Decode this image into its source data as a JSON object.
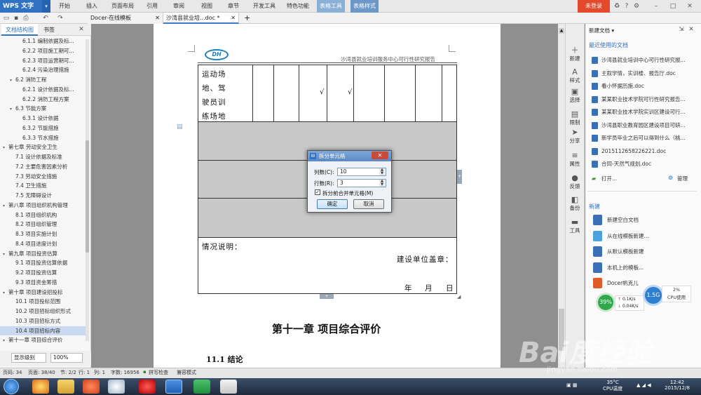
{
  "app": {
    "name": "WPS 文字",
    "dropdown": "▾"
  },
  "menu": [
    "开始",
    "插入",
    "页面布局",
    "引用",
    "审阅",
    "视图",
    "章节",
    "开发工具",
    "特色功能"
  ],
  "context_menu": [
    "表格工具",
    "表格样式"
  ],
  "login_label": "未登录",
  "tabs": [
    {
      "label": "Docer-在线模板"
    },
    {
      "label": "沙湾县就业培...doc *"
    }
  ],
  "new_tab": "+",
  "left_panel": {
    "tabs": [
      "文档结构图",
      "书签"
    ],
    "outline": [
      {
        "label": "6.1.1 编制依据及标...",
        "level": 3
      },
      {
        "label": "6.2.2 项目施工期可...",
        "level": 3
      },
      {
        "label": "6.2.3 项目运营期可...",
        "level": 3
      },
      {
        "label": "6.2.4 污染治理措施",
        "level": 3
      },
      {
        "label": "6.2 消防工程",
        "level": 2,
        "collapse": "▾"
      },
      {
        "label": "6.2.1 设计依据及标...",
        "level": 3
      },
      {
        "label": "6.2.2 消防工程方案",
        "level": 3
      },
      {
        "label": "6.3 节能方案",
        "level": 2,
        "collapse": "▾"
      },
      {
        "label": "6.3.1 设计依据",
        "level": 3
      },
      {
        "label": "6.3.2 节能措施",
        "level": 3
      },
      {
        "label": "6.3.3 节水措施",
        "level": 3
      },
      {
        "label": "第七章 劳动安全卫生",
        "level": 1,
        "collapse": "▾"
      },
      {
        "label": "7.1 设计依据及标准",
        "level": 2
      },
      {
        "label": "7.2 主要危害因素分析",
        "level": 2
      },
      {
        "label": "7.3 劳动安全措施",
        "level": 2
      },
      {
        "label": "7.4 卫生措施",
        "level": 2
      },
      {
        "label": "7.5 无障碍设计",
        "level": 2
      },
      {
        "label": "第八章 项目组织机构管理",
        "level": 1,
        "collapse": "▾"
      },
      {
        "label": "8.1 项目组织机构",
        "level": 2
      },
      {
        "label": "8.2 项目组织管理",
        "level": 2
      },
      {
        "label": "8.3 项目实施计划",
        "level": 2
      },
      {
        "label": "8.4 项目进度计划",
        "level": 2
      },
      {
        "label": "第九章 项目投资估算",
        "level": 1,
        "collapse": "▾"
      },
      {
        "label": "9.1 项目投资估算依据",
        "level": 2
      },
      {
        "label": "9.2 项目投资估算",
        "level": 2
      },
      {
        "label": "9.3 项目资金筹措",
        "level": 2
      },
      {
        "label": "第十章 项目建设招投标",
        "level": 1,
        "collapse": "▾"
      },
      {
        "label": "10.1 项目投标范围",
        "level": 2
      },
      {
        "label": "10.2 项目招标组织形式",
        "level": 2
      },
      {
        "label": "10.3 项目招标方式",
        "level": 2
      },
      {
        "label": "10.4 项目招标内容",
        "level": 2,
        "selected": true
      },
      {
        "label": "第十一章 项目综合评价",
        "level": 1,
        "collapse": "▾"
      }
    ],
    "level_select": "显示级别",
    "zoom_select": "100%"
  },
  "document": {
    "header_text": "沙湾县就业培训服务中心可行性研究报告",
    "logo_text": "DH",
    "cell_lines": [
      "运动场",
      "地、驾",
      "驶员训",
      "练场地"
    ],
    "checks": [
      "√",
      "√"
    ],
    "notes_label": "情况说明：",
    "seal_label": "建设单位盖章：",
    "date_labels": [
      "年",
      "月",
      "日"
    ],
    "chapter_title": "第十一章  项目综合评价",
    "section_title": "11.1  结论"
  },
  "dialog": {
    "title": "拆分单元格",
    "close": "✕",
    "cols_label": "列数(C):",
    "cols_value": "10",
    "rows_label": "行数(R):",
    "rows_value": "3",
    "merge_label": "拆分前合并单元格(M)",
    "merge_checked": "✓",
    "ok_label": "确定",
    "cancel_label": "取消"
  },
  "right_strip": [
    {
      "label": "新建",
      "icon": "new-icon",
      "glyph": "＋"
    },
    {
      "label": "样式",
      "icon": "style-icon",
      "glyph": "A"
    },
    {
      "label": "选择",
      "icon": "select-icon",
      "glyph": "▣"
    },
    {
      "label": "限制",
      "icon": "restrict-icon",
      "glyph": "▤"
    },
    {
      "label": "分享",
      "icon": "share-icon",
      "glyph": "➤"
    },
    {
      "label": "属性",
      "icon": "properties-icon",
      "glyph": "≡"
    },
    {
      "label": "反馈",
      "icon": "feedback-icon",
      "glyph": "●"
    },
    {
      "label": "备份",
      "icon": "backup-icon",
      "glyph": "◧"
    },
    {
      "label": "工具",
      "icon": "tools-icon",
      "glyph": "▬"
    }
  ],
  "right_panel": {
    "header": "新建文档 ▾",
    "recent_title": "最近使用的文档",
    "recent": [
      "沙湾县就业培训中心可行性研究报...",
      "主叙学情，实训楼、报告厅.doc",
      "看小怀据历施.doc",
      "某某职业技术学院可行性研究报告...",
      "某某职业技术学院实训区建设可行...",
      "沙湾县职业教育园区建设项目可研...",
      "新学员毕业之后可以得到什么（桃...",
      "2015112658226221.doc",
      "合同-天然气规划.doc"
    ],
    "open_label": "打开...",
    "manage_label": "管理",
    "new_title": "新建",
    "new_items": [
      "新建空白文档",
      "从在线模板新建...",
      "从默认模板新建",
      "本机上的模板...",
      "Docer帆克儿"
    ]
  },
  "widgets": {
    "mem": "39%",
    "cpu": "1.5G",
    "up": "0.1K/s",
    "down": "0.04K/s",
    "cpu_pct": "2%",
    "cpu_label": "CPU使用"
  },
  "status": {
    "page": "页码: 34",
    "pages": "页面: 38/40",
    "section": "节: 2/2",
    "row": "行: 1",
    "col": "列: 1",
    "words": "字数: 16956",
    "spell": "拼写检查",
    "compat": "兼容模式"
  },
  "taskbar": {
    "temp": "35°C",
    "temp_label": "CPU温度",
    "time": "12:42",
    "date": "2015/12/8"
  },
  "watermark": {
    "text": "Bai度经验",
    "url": "jingyan.baidu.com"
  }
}
